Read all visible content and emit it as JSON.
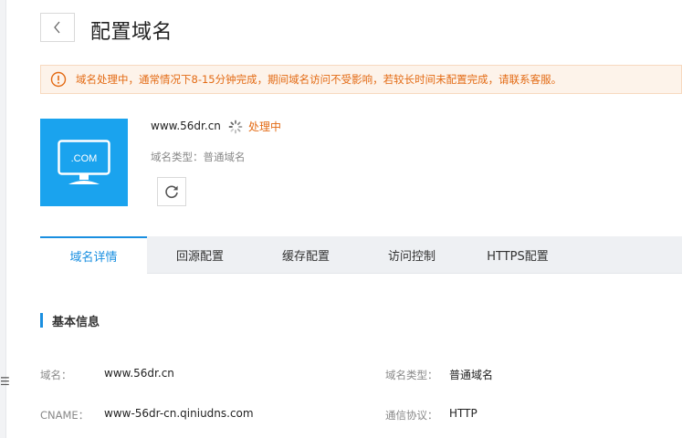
{
  "page": {
    "title": "配置域名"
  },
  "alert": {
    "text": "域名处理中，通常情况下8-15分钟完成，期间域名访问不受影响，若较长时间未配置完成，请联系客服。"
  },
  "domain": {
    "logo_text": ".COM",
    "name": "www.56dr.cn",
    "status": "处理中",
    "type_line": "域名类型：普通域名"
  },
  "tabs": [
    {
      "label": "域名详情",
      "active": true
    },
    {
      "label": "回源配置"
    },
    {
      "label": "缓存配置"
    },
    {
      "label": "访问控制"
    },
    {
      "label": "HTTPS配置"
    }
  ],
  "section": {
    "title": "基本信息"
  },
  "fields": {
    "domain_label": "域名：",
    "domain_value": "www.56dr.cn",
    "type_label": "域名类型：",
    "type_value": "普通域名",
    "cname_label": "CNAME：",
    "cname_value": "www-56dr-cn.qiniudns.com",
    "protocol_label": "通信协议：",
    "protocol_value": "HTTP"
  },
  "colors": {
    "accent": "#1a8fe0",
    "warning": "#e36a13",
    "logo_bg": "#1aa3ee"
  },
  "icons": [
    "chevron-left-icon",
    "warning-circle-icon",
    "monitor-icon",
    "spinner-icon",
    "refresh-icon"
  ]
}
